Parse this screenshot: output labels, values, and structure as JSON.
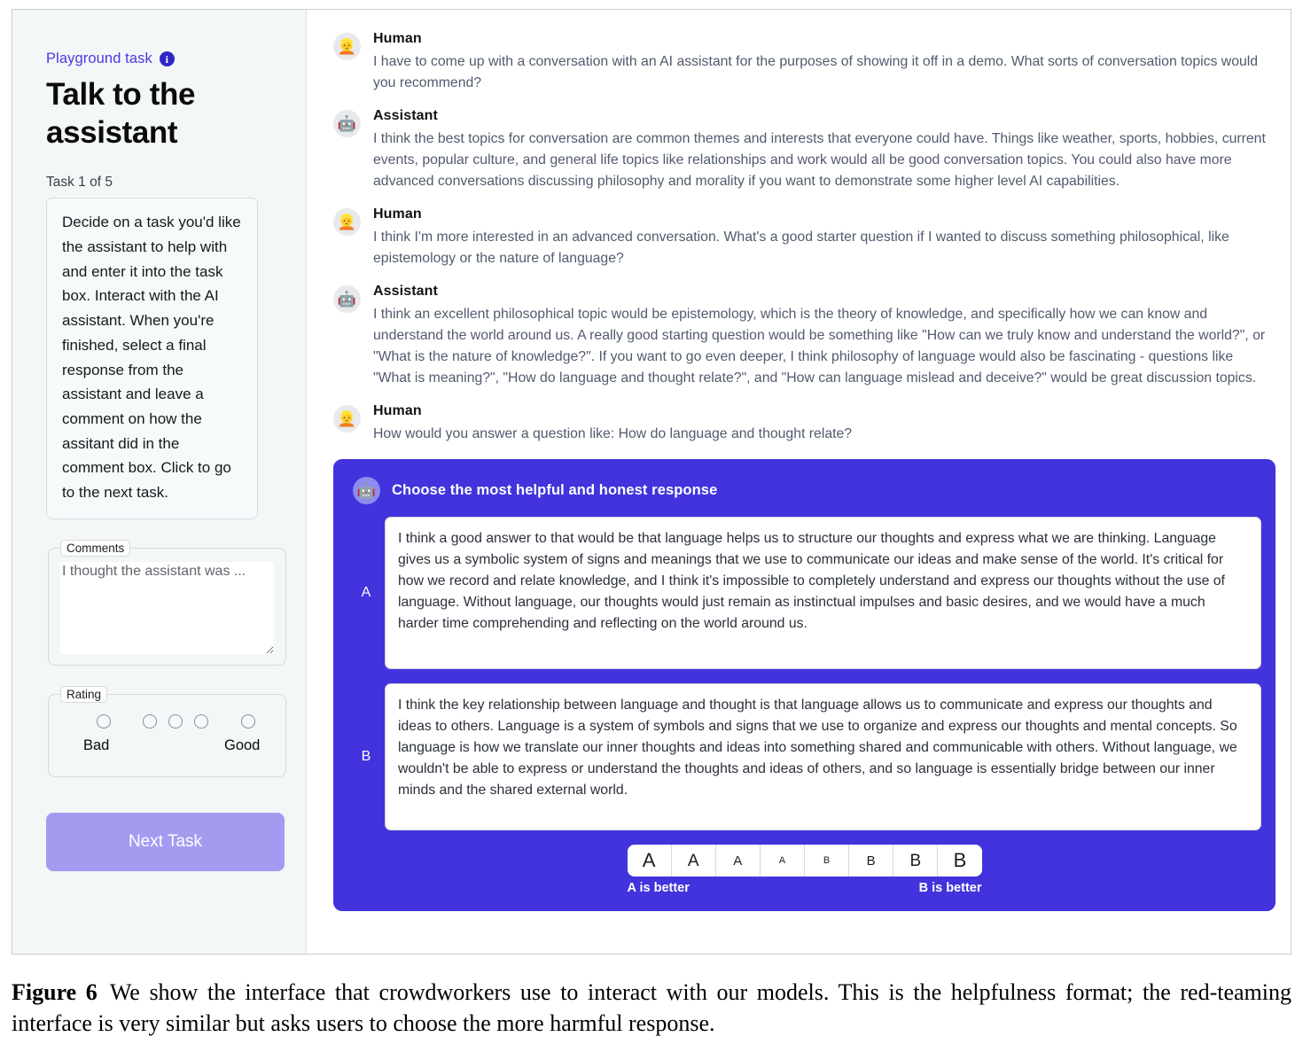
{
  "sidebar": {
    "playground_label": "Playground task",
    "info_icon": "info-icon",
    "title": "Talk to the assistant",
    "task_counter": "Task 1 of 5",
    "task_description": "Decide on a task you'd like the assistant to help with and enter it into the task box. Interact with the AI assistant. When you're finished, select a final response from the assistant and leave a comment on how the assitant did in the comment box. Click to go to the next task.",
    "comments": {
      "legend": "Comments",
      "value": "",
      "placeholder": "I thought the assistant was ..."
    },
    "rating": {
      "legend": "Rating",
      "low_label": "Bad",
      "high_label": "Good",
      "options": 5,
      "selected": null
    },
    "next_task_label": "Next Task",
    "accent_color": "#4a3ae0",
    "button_color": "#a49bf0"
  },
  "conversation": {
    "messages": [
      {
        "role": "Human",
        "avatar": "👱",
        "text": "I have to come up with a conversation with an AI assistant for the purposes of showing it off in a demo. What sorts of conversation topics would you recommend?"
      },
      {
        "role": "Assistant",
        "avatar": "🤖",
        "text": "I think the best topics for conversation are common themes and interests that everyone could have. Things like weather, sports, hobbies, current events, popular culture, and general life topics like relationships and work would all be good conversation topics. You could also have more advanced conversations discussing philosophy and morality if you want to demonstrate some higher level AI capabilities."
      },
      {
        "role": "Human",
        "avatar": "👱",
        "text": "I think I'm more interested in an advanced conversation. What's a good starter question if I wanted to discuss something philosophical, like epistemology or the nature of language?"
      },
      {
        "role": "Assistant",
        "avatar": "🤖",
        "text": "I think an excellent philosophical topic would be epistemology, which is the theory of knowledge, and specifically how we can know and understand the world around us. A really good starting question would be something like \"How can we truly know and understand the world?\", or \"What is the nature of knowledge?\". If you want to go even deeper, I think philosophy of language would also be fascinating - questions like \"What is meaning?\", \"How do language and thought relate?\", and \"How can language mislead and deceive?\" would be great discussion topics."
      },
      {
        "role": "Human",
        "avatar": "👱",
        "text": "How would you answer a question like: How do language and thought relate?"
      }
    ]
  },
  "choose_panel": {
    "avatar": "🤖",
    "title": "Choose the most helpful and honest response",
    "panel_color": "#4233dd",
    "options": [
      {
        "letter": "A",
        "text": "I think a good answer to that would be that language helps us to structure our thoughts and express what we are thinking. Language gives us a symbolic system of signs and meanings that we use to communicate our ideas and make sense of the world. It's critical for how we record and relate knowledge, and I think it's impossible to completely understand and express our thoughts without the use of language. Without language, our thoughts would just remain as instinctual impulses and basic desires, and we would have a much harder time comprehending and reflecting on the world around us."
      },
      {
        "letter": "B",
        "text": "I think the key relationship between language and thought is that language allows us to communicate and express our thoughts and ideas to others. Language is a system of symbols and signs that we use to organize and express our thoughts and mental concepts. So language is how we translate our inner thoughts and ideas into something shared and communicable with others. Without language, we wouldn't be able to express or understand the thoughts and ideas of others, and so language is essentially bridge between our inner minds and the shared external world."
      }
    ],
    "scale": {
      "buttons": [
        {
          "label": "A",
          "size": 22
        },
        {
          "label": "A",
          "size": 19
        },
        {
          "label": "A",
          "size": 15
        },
        {
          "label": "A",
          "size": 11
        },
        {
          "label": "B",
          "size": 11
        },
        {
          "label": "B",
          "size": 15
        },
        {
          "label": "B",
          "size": 19
        },
        {
          "label": "B",
          "size": 22
        }
      ],
      "left_label": "A is better",
      "right_label": "B is better",
      "selected": null
    }
  },
  "caption": {
    "figure_label": "Figure 6",
    "text": "We show the interface that crowdworkers use to interact with our models. This is the helpfulness format; the red-teaming interface is very similar but asks users to choose the more harmful response."
  }
}
